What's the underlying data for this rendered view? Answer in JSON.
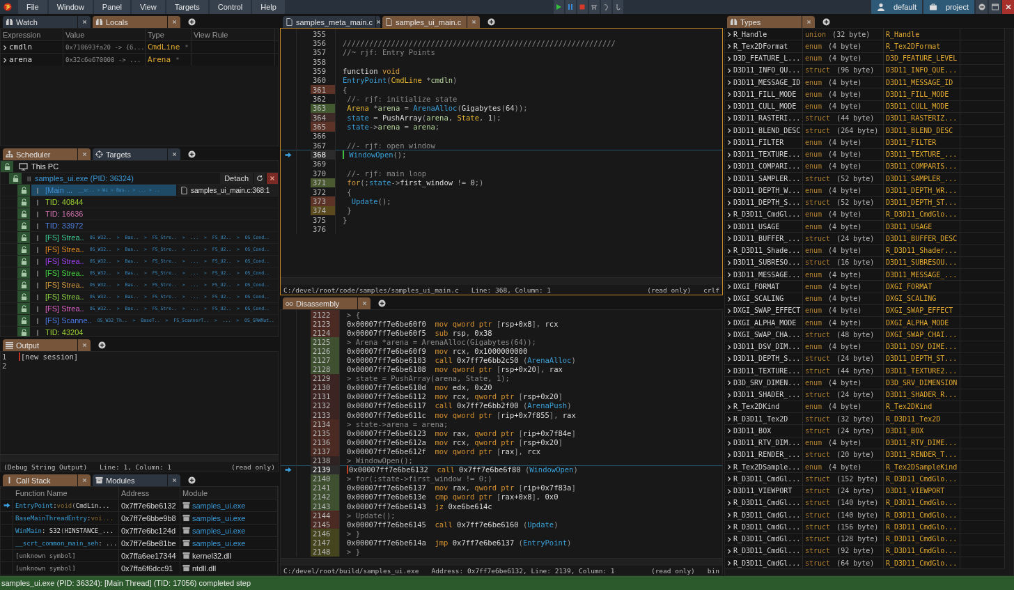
{
  "menu_bar": {
    "items": [
      "File",
      "Window",
      "Panel",
      "View",
      "Targets",
      "Control",
      "Help"
    ],
    "profiles": [
      "default",
      "project"
    ]
  },
  "watch": {
    "tabs": [
      {
        "label": "Watch",
        "selected": false
      },
      {
        "label": "Locals",
        "selected": true
      }
    ],
    "columns": [
      "Expression",
      "Value",
      "Type",
      "View Rule"
    ],
    "rows": [
      {
        "expression": "cmdln",
        "value": "0x710693fa20 -> {6...",
        "type": "CmdLine",
        "marker": "*"
      },
      {
        "expression": "arena",
        "value": "0x32c6e670000 -> ...",
        "type": "Arena",
        "marker": "*"
      }
    ]
  },
  "scheduler": {
    "tabs": [
      {
        "label": "Scheduler",
        "selected": true
      },
      {
        "label": "Targets",
        "selected": false
      }
    ],
    "machine": {
      "label": "This PC"
    },
    "process": {
      "label": "samples_ui.exe (PID: 36324)",
      "button": "Detach"
    },
    "threads": [
      {
        "label": "[Main ...",
        "color": "#3f8fd0",
        "selected": true,
        "trail": "__sc.. > Wi > Bas.. > ... > ..",
        "location": "samples_ui_main.c:368:1"
      },
      {
        "label": "TID: 40844",
        "color": "#9acd32",
        "selected": false
      },
      {
        "label": "TID: 16636",
        "color": "#d070b0",
        "selected": false
      },
      {
        "label": "TID: 33972",
        "color": "#4f7fe0",
        "selected": false
      },
      {
        "label": "[FS] Strea..",
        "color": "#3cc890",
        "selected": false,
        "trail": "OS_W32..  >  Bas..  >  FS_Stre..  >  ...  >  FS_U2..  >  OS_Cond.."
      },
      {
        "label": "[FS] Strea..",
        "color": "#e08a20",
        "selected": false,
        "trail": "OS_W32..  >  Bas..  >  FS_Stre..  >  ...  >  FS_U2..  >  OS_Cond.."
      },
      {
        "label": "[FS] Strea..",
        "color": "#a040f0",
        "selected": false,
        "trail": "OS_W32..  >  Bas..  >  FS_Stre..  >  ...  >  FS_U2..  >  OS_Cond.."
      },
      {
        "label": "[FS] Strea..",
        "color": "#40d040",
        "selected": false,
        "trail": "OS_W32..  >  Bas..  >  FS_Stre..  >  ...  >  FS_U2..  >  OS_Cond.."
      },
      {
        "label": "[FS] Strea..",
        "color": "#d09a40",
        "selected": false,
        "trail": "OS_W32..  >  Bas..  >  FS_Stre..  >  ...  >  FS_U2..  >  OS_Cond.."
      },
      {
        "label": "[FS] Strea..",
        "color": "#8ad040",
        "selected": false,
        "trail": "OS_W32..  >  Bas..  >  FS_Stre..  >  ...  >  FS_U2..  >  OS_Cond.."
      },
      {
        "label": "[FS] Strea..",
        "color": "#e060c8",
        "selected": false,
        "trail": "OS_W32..  >  Bas..  >  FS_Stre..  >  ...  >  FS_U2..  >  OS_Cond.."
      },
      {
        "label": "[FS] Scanne..",
        "color": "#4a7ae8",
        "selected": false,
        "trail": "OS_W32_Th..  >  BaseT..  >  FS_ScannerT..  >  ...  >  OS_SRWMut.."
      },
      {
        "label": "TID: 43204",
        "color": "#9acd32",
        "selected": false
      }
    ]
  },
  "output": {
    "tabs": [
      {
        "label": "Output",
        "selected": true
      }
    ],
    "lines": [
      {
        "n": "1",
        "text": "[new session]"
      },
      {
        "n": "2"
      }
    ],
    "status": [
      "(Debug String Output)",
      "Line: 1, Column: 1",
      "(read only)"
    ]
  },
  "call_stack": {
    "tabs": [
      {
        "label": "Call Stack",
        "selected": true
      },
      {
        "label": "Modules",
        "selected": false
      }
    ],
    "columns": [
      "Function Name",
      "Address",
      "Module"
    ],
    "rows": [
      {
        "current": true,
        "function": [
          {
            "kind": "f",
            "text": "EntryPoint"
          },
          {
            "kind": "p",
            "text": ": "
          },
          {
            "kind": "k",
            "text": "void"
          },
          {
            "kind": "o",
            "text": " ("
          },
          {
            "kind": "p",
            "text": "CmdLin..."
          }
        ],
        "address": "0x7ff7e6be6132",
        "module": "samples_ui.exe",
        "kind": "own"
      },
      {
        "current": false,
        "function": [
          {
            "kind": "f",
            "text": "BaseMainThreadEntry"
          },
          {
            "kind": "p",
            "text": ": "
          },
          {
            "kind": "k",
            "text": "voi..."
          }
        ],
        "address": "0x7ff7e6bbe9b8",
        "module": "samples_ui.exe",
        "kind": "own"
      },
      {
        "current": false,
        "function": [
          {
            "kind": "f",
            "text": "WinMain"
          },
          {
            "kind": "p",
            "text": ": S32 "
          },
          {
            "kind": "o",
            "text": "("
          },
          {
            "kind": "p",
            "text": "HINSTANCE_..."
          }
        ],
        "address": "0x7ff7e6bc124d",
        "module": "samples_ui.exe",
        "kind": "own"
      },
      {
        "current": false,
        "function": [
          {
            "kind": "f",
            "text": "__scrt_common_main_seh"
          },
          {
            "kind": "p",
            "text": ": ..."
          }
        ],
        "address": "0x7ff7e6be81be",
        "module": "samples_ui.exe",
        "kind": "own"
      },
      {
        "current": false,
        "function": [
          {
            "kind": "o",
            "text": "[unknown symbol]"
          }
        ],
        "address": "0x7ffa6ee17344",
        "module": "kernel32.dll",
        "kind": "system"
      },
      {
        "current": false,
        "function": [
          {
            "kind": "o",
            "text": "[unknown symbol]"
          }
        ],
        "address": "0x7ffa6f6dcc91",
        "module": "ntdll.dll",
        "kind": "system"
      }
    ]
  },
  "editor": {
    "tabs": [
      {
        "label": "samples_meta_main.c",
        "selected": false
      },
      {
        "label": "samples_ui_main.c",
        "selected": true
      }
    ],
    "lines": [
      {
        "n": "355",
        "current": false
      },
      {
        "n": "356",
        "current": false,
        "tokens": [
          {
            "kind": "c",
            "text": "//////////////////////////////////////////////////////////////"
          }
        ]
      },
      {
        "n": "357",
        "current": false,
        "tokens": [
          {
            "kind": "c",
            "text": "//~ rjf: Entry Points"
          }
        ]
      },
      {
        "n": "358",
        "current": false
      },
      {
        "n": "359",
        "current": false,
        "tokens": [
          {
            "kind": "p",
            "text": "function "
          },
          {
            "kind": "k",
            "text": "void"
          }
        ]
      },
      {
        "n": "360",
        "current": false,
        "tokens": [
          {
            "kind": "f",
            "text": "EntryPoint"
          },
          {
            "kind": "o",
            "text": "("
          },
          {
            "kind": "t",
            "text": "CmdLine"
          },
          {
            "kind": "o",
            "text": " *"
          },
          {
            "kind": "v",
            "text": "cmdln"
          },
          {
            "kind": "o",
            "text": ")"
          }
        ]
      },
      {
        "n": "361",
        "current": false,
        "color": "#5c3326",
        "tokens": [
          {
            "kind": "o",
            "text": "{"
          }
        ]
      },
      {
        "n": "362",
        "current": false,
        "tokens": [
          {
            "kind": "c",
            "text": " //- rjf: initialize state"
          }
        ]
      },
      {
        "n": "363",
        "current": false,
        "color": "#435a30",
        "tokens": [
          {
            "kind": "t",
            "text": " Arena"
          },
          {
            "kind": "o",
            "text": " *"
          },
          {
            "kind": "v",
            "text": "arena"
          },
          {
            "kind": "o",
            "text": " = "
          },
          {
            "kind": "f",
            "text": "ArenaAlloc"
          },
          {
            "kind": "o",
            "text": "("
          },
          {
            "kind": "p",
            "text": "Gigabytes"
          },
          {
            "kind": "o",
            "text": "("
          },
          {
            "kind": "n",
            "text": "64"
          },
          {
            "kind": "o",
            "text": "));"
          }
        ]
      },
      {
        "n": "364",
        "current": false,
        "color": "#3e2a26",
        "tokens": [
          {
            "kind": "f",
            "text": " state"
          },
          {
            "kind": "o",
            "text": " = "
          },
          {
            "kind": "p",
            "text": "PushArray"
          },
          {
            "kind": "o",
            "text": "("
          },
          {
            "kind": "v",
            "text": "arena"
          },
          {
            "kind": "o",
            "text": ", "
          },
          {
            "kind": "t",
            "text": "State"
          },
          {
            "kind": "o",
            "text": ", "
          },
          {
            "kind": "n",
            "text": "1"
          },
          {
            "kind": "o",
            "text": ");"
          }
        ]
      },
      {
        "n": "365",
        "current": false,
        "color": "#5c3326",
        "tokens": [
          {
            "kind": "f",
            "text": " state"
          },
          {
            "kind": "o",
            "text": "->"
          },
          {
            "kind": "v",
            "text": "arena"
          },
          {
            "kind": "o",
            "text": " = "
          },
          {
            "kind": "v",
            "text": "arena"
          },
          {
            "kind": "o",
            "text": ";"
          }
        ]
      },
      {
        "n": "366",
        "current": false
      },
      {
        "n": "367",
        "current": false,
        "tokens": [
          {
            "kind": "c",
            "text": " //- rjf: open window"
          }
        ]
      },
      {
        "n": "368",
        "current": true,
        "tokens": [
          {
            "kind": "f",
            "text": " WindowOpen"
          },
          {
            "kind": "o",
            "text": "();"
          }
        ]
      },
      {
        "n": "369",
        "current": false
      },
      {
        "n": "370",
        "current": false,
        "tokens": [
          {
            "kind": "c",
            "text": " //- rjf: main loop"
          }
        ]
      },
      {
        "n": "371",
        "current": false,
        "color": "#4b5a30",
        "tokens": [
          {
            "kind": "k",
            "text": " for"
          },
          {
            "kind": "o",
            "text": "(;"
          },
          {
            "kind": "f",
            "text": "state"
          },
          {
            "kind": "o",
            "text": "->"
          },
          {
            "kind": "p",
            "text": "first_window"
          },
          {
            "kind": "o",
            "text": " != "
          },
          {
            "kind": "n",
            "text": "0"
          },
          {
            "kind": "o",
            "text": ";)"
          }
        ]
      },
      {
        "n": "372",
        "current": false,
        "tokens": [
          {
            "kind": "o",
            "text": " {"
          }
        ]
      },
      {
        "n": "373",
        "current": false,
        "color": "#5c3326",
        "tokens": [
          {
            "kind": "f",
            "text": "  Update"
          },
          {
            "kind": "o",
            "text": "();"
          }
        ]
      },
      {
        "n": "374",
        "current": false,
        "color": "#5a4a1e",
        "tokens": [
          {
            "kind": "o",
            "text": " }"
          }
        ]
      },
      {
        "n": "375",
        "current": false,
        "tokens": [
          {
            "kind": "o",
            "text": "}"
          }
        ]
      },
      {
        "n": "376",
        "current": false
      }
    ],
    "status": {
      "path": "C:/devel/root/code/samples/samples_ui_main.c",
      "position": "Line: 368, Column: 1",
      "mode": "(read only)",
      "ending": "crlf"
    }
  },
  "disassembly": {
    "tabs": [
      {
        "label": "Disassembly",
        "selected": true
      }
    ],
    "lines": [
      {
        "n": "2122",
        "current": false,
        "color": "#4a2a22",
        "tokens": [
          {
            "kind": "s",
            "text": "> {"
          }
        ]
      },
      {
        "n": "2123",
        "current": false,
        "color": "#4a2a22",
        "tokens": [
          {
            "kind": "a",
            "text": "0x00007ff7e6be60f0"
          },
          {
            "kind": "m",
            "text": "  mov qword ptr "
          },
          {
            "kind": "o",
            "text": "["
          },
          {
            "kind": "p",
            "text": "rsp+0x8"
          },
          {
            "kind": "o",
            "text": "], "
          },
          {
            "kind": "p",
            "text": "rcx"
          }
        ]
      },
      {
        "n": "2124",
        "current": false,
        "color": "#4a2a22",
        "tokens": [
          {
            "kind": "a",
            "text": "0x00007ff7e6be60f5"
          },
          {
            "kind": "m",
            "text": "  sub "
          },
          {
            "kind": "p",
            "text": "rsp"
          },
          {
            "kind": "o",
            "text": ", "
          },
          {
            "kind": "p",
            "text": "0x38"
          }
        ]
      },
      {
        "n": "2125",
        "current": false,
        "color": "#3e5030",
        "tokens": [
          {
            "kind": "s",
            "text": "> Arena *arena = ArenaAlloc(Gigabytes(64));"
          }
        ]
      },
      {
        "n": "2126",
        "current": false,
        "color": "#3e5030",
        "tokens": [
          {
            "kind": "a",
            "text": "0x00007ff7e6be60f9"
          },
          {
            "kind": "m",
            "text": "  mov "
          },
          {
            "kind": "p",
            "text": "rcx"
          },
          {
            "kind": "o",
            "text": ", "
          },
          {
            "kind": "p",
            "text": "0x1000000000"
          }
        ]
      },
      {
        "n": "2127",
        "current": false,
        "color": "#3e5030",
        "tokens": [
          {
            "kind": "a",
            "text": "0x00007ff7e6be6103"
          },
          {
            "kind": "m",
            "text": "  call "
          },
          {
            "kind": "p",
            "text": "0x7ff7e6bb2c50 "
          },
          {
            "kind": "o",
            "text": "("
          },
          {
            "kind": "f",
            "text": "ArenaAlloc"
          },
          {
            "kind": "o",
            "text": ")"
          }
        ]
      },
      {
        "n": "2128",
        "current": false,
        "color": "#3e5030",
        "tokens": [
          {
            "kind": "a",
            "text": "0x00007ff7e6be6108"
          },
          {
            "kind": "m",
            "text": "  mov qword ptr "
          },
          {
            "kind": "o",
            "text": "["
          },
          {
            "kind": "p",
            "text": "rsp+0x20"
          },
          {
            "kind": "o",
            "text": "], "
          },
          {
            "kind": "p",
            "text": "rax"
          }
        ]
      },
      {
        "n": "2129",
        "current": false,
        "color": "#3b2422",
        "tokens": [
          {
            "kind": "s",
            "text": "> state = PushArray(arena, State, 1);"
          }
        ]
      },
      {
        "n": "2130",
        "current": false,
        "color": "#3b2422",
        "tokens": [
          {
            "kind": "a",
            "text": "0x00007ff7e6be610d"
          },
          {
            "kind": "m",
            "text": "  mov "
          },
          {
            "kind": "p",
            "text": "edx"
          },
          {
            "kind": "o",
            "text": ", "
          },
          {
            "kind": "p",
            "text": "0x20"
          }
        ]
      },
      {
        "n": "2131",
        "current": false,
        "color": "#3b2422",
        "tokens": [
          {
            "kind": "a",
            "text": "0x00007ff7e6be6112"
          },
          {
            "kind": "m",
            "text": "  mov "
          },
          {
            "kind": "p",
            "text": "rcx"
          },
          {
            "kind": "o",
            "text": ", "
          },
          {
            "kind": "m",
            "text": "qword ptr "
          },
          {
            "kind": "o",
            "text": "["
          },
          {
            "kind": "p",
            "text": "rsp+0x20"
          },
          {
            "kind": "o",
            "text": "]"
          }
        ]
      },
      {
        "n": "2132",
        "current": false,
        "color": "#3b2422",
        "tokens": [
          {
            "kind": "a",
            "text": "0x00007ff7e6be6117"
          },
          {
            "kind": "m",
            "text": "  call "
          },
          {
            "kind": "p",
            "text": "0x7ff7e6bb2f00 "
          },
          {
            "kind": "o",
            "text": "("
          },
          {
            "kind": "f",
            "text": "ArenaPush"
          },
          {
            "kind": "o",
            "text": ")"
          }
        ]
      },
      {
        "n": "2133",
        "current": false,
        "color": "#3b2422",
        "tokens": [
          {
            "kind": "a",
            "text": "0x00007ff7e6be611c"
          },
          {
            "kind": "m",
            "text": "  mov qword ptr "
          },
          {
            "kind": "o",
            "text": "["
          },
          {
            "kind": "p",
            "text": "rip+0x7f855"
          },
          {
            "kind": "o",
            "text": "], "
          },
          {
            "kind": "p",
            "text": "rax"
          }
        ]
      },
      {
        "n": "2134",
        "current": false,
        "color": "#4a2a22",
        "tokens": [
          {
            "kind": "s",
            "text": "> state->arena = arena;"
          }
        ]
      },
      {
        "n": "2135",
        "current": false,
        "color": "#4a2a22",
        "tokens": [
          {
            "kind": "a",
            "text": "0x00007ff7e6be6123"
          },
          {
            "kind": "m",
            "text": "  mov "
          },
          {
            "kind": "p",
            "text": "rax"
          },
          {
            "kind": "o",
            "text": ", "
          },
          {
            "kind": "m",
            "text": "qword ptr "
          },
          {
            "kind": "o",
            "text": "["
          },
          {
            "kind": "p",
            "text": "rip+0x7f84e"
          },
          {
            "kind": "o",
            "text": "]"
          }
        ]
      },
      {
        "n": "2136",
        "current": false,
        "color": "#4a2a22",
        "tokens": [
          {
            "kind": "a",
            "text": "0x00007ff7e6be612a"
          },
          {
            "kind": "m",
            "text": "  mov "
          },
          {
            "kind": "p",
            "text": "rcx"
          },
          {
            "kind": "o",
            "text": ", "
          },
          {
            "kind": "m",
            "text": "qword ptr "
          },
          {
            "kind": "o",
            "text": "["
          },
          {
            "kind": "p",
            "text": "rsp+0x20"
          },
          {
            "kind": "o",
            "text": "]"
          }
        ]
      },
      {
        "n": "2137",
        "current": false,
        "color": "#4a2a22",
        "tokens": [
          {
            "kind": "a",
            "text": "0x00007ff7e6be612f"
          },
          {
            "kind": "m",
            "text": "  mov qword ptr "
          },
          {
            "kind": "o",
            "text": "["
          },
          {
            "kind": "p",
            "text": "rax"
          },
          {
            "kind": "o",
            "text": "], "
          },
          {
            "kind": "p",
            "text": "rcx"
          }
        ]
      },
      {
        "n": "2138",
        "current": false,
        "color": "#2e2222",
        "tokens": [
          {
            "kind": "s",
            "text": "> WindowOpen();"
          }
        ]
      },
      {
        "n": "2139",
        "current": true,
        "tokens": [
          {
            "kind": "a",
            "text": "0x00007ff7e6be6132"
          },
          {
            "kind": "m",
            "text": "  call "
          },
          {
            "kind": "p",
            "text": "0x7ff7e6be6f80 "
          },
          {
            "kind": "o",
            "text": "("
          },
          {
            "kind": "f",
            "text": "WindowOpen"
          },
          {
            "kind": "o",
            "text": ")"
          }
        ]
      },
      {
        "n": "2140",
        "current": false,
        "color": "#3e5030",
        "tokens": [
          {
            "kind": "s",
            "text": "> for(;state->first_window != 0;)"
          }
        ]
      },
      {
        "n": "2141",
        "current": false,
        "color": "#3e5030",
        "tokens": [
          {
            "kind": "a",
            "text": "0x00007ff7e6be6137"
          },
          {
            "kind": "m",
            "text": "  mov "
          },
          {
            "kind": "p",
            "text": "rax"
          },
          {
            "kind": "o",
            "text": ", "
          },
          {
            "kind": "m",
            "text": "qword ptr "
          },
          {
            "kind": "o",
            "text": "["
          },
          {
            "kind": "p",
            "text": "rip+0x7f83a"
          },
          {
            "kind": "o",
            "text": "]"
          }
        ]
      },
      {
        "n": "2142",
        "current": false,
        "color": "#3e5030",
        "tokens": [
          {
            "kind": "a",
            "text": "0x00007ff7e6be613e"
          },
          {
            "kind": "m",
            "text": "  cmp qword ptr "
          },
          {
            "kind": "o",
            "text": "["
          },
          {
            "kind": "p",
            "text": "rax+0x8"
          },
          {
            "kind": "o",
            "text": "], "
          },
          {
            "kind": "p",
            "text": "0x0"
          }
        ]
      },
      {
        "n": "2143",
        "current": false,
        "color": "#3e5030",
        "tokens": [
          {
            "kind": "a",
            "text": "0x00007ff7e6be6143"
          },
          {
            "kind": "m",
            "text": "  jz "
          },
          {
            "kind": "p",
            "text": "0xe6be614c"
          }
        ]
      },
      {
        "n": "2144",
        "current": false,
        "color": "#4a2a22",
        "tokens": [
          {
            "kind": "s",
            "text": "> Update();"
          }
        ]
      },
      {
        "n": "2145",
        "current": false,
        "color": "#4a2a22",
        "tokens": [
          {
            "kind": "a",
            "text": "0x00007ff7e6be6145"
          },
          {
            "kind": "m",
            "text": "  call "
          },
          {
            "kind": "p",
            "text": "0x7ff7e6be6160 "
          },
          {
            "kind": "o",
            "text": "("
          },
          {
            "kind": "f",
            "text": "Update"
          },
          {
            "kind": "o",
            "text": ")"
          }
        ]
      },
      {
        "n": "2146",
        "current": false,
        "color": "#44441e",
        "tokens": [
          {
            "kind": "s",
            "text": "> }"
          }
        ]
      },
      {
        "n": "2147",
        "current": false,
        "color": "#44441e",
        "tokens": [
          {
            "kind": "a",
            "text": "0x00007ff7e6be614a"
          },
          {
            "kind": "m",
            "text": "  jmp "
          },
          {
            "kind": "p",
            "text": "0x7ff7e6be6137 "
          },
          {
            "kind": "o",
            "text": "("
          },
          {
            "kind": "f",
            "text": "EntryPoint"
          },
          {
            "kind": "o",
            "text": ")"
          }
        ]
      },
      {
        "n": "2148",
        "current": false,
        "color": "#44441e",
        "tokens": [
          {
            "kind": "s",
            "text": "> }"
          }
        ]
      }
    ],
    "status": {
      "path": "C:/devel/root/build/samples_ui.exe",
      "position": "Address: 0x7ff7e6be6132, Line: 2139, Column: 1",
      "mode": "(read only)",
      "ending": "bin"
    }
  },
  "types": {
    "tabs": [
      {
        "label": "Types",
        "selected": true
      }
    ],
    "rows": [
      {
        "name": "R_Handle",
        "category": "union",
        "size": "(32 byte)",
        "type": "R_Handle"
      },
      {
        "name": "R_Tex2DFormat",
        "category": "enum",
        "size": "(4 byte)",
        "type": "R_Tex2DFormat"
      },
      {
        "name": "D3D_FEATURE_L...",
        "category": "enum",
        "size": "(4 byte)",
        "type": "D3D_FEATURE_LEVEL"
      },
      {
        "name": "D3D11_INFO_QU...",
        "category": "struct",
        "size": "(96 byte)",
        "type": "D3D11_INFO_QUE..."
      },
      {
        "name": "D3D11_MESSAGE_ID",
        "category": "enum",
        "size": "(4 byte)",
        "type": "D3D11_MESSAGE_ID"
      },
      {
        "name": "D3D11_FILL_MODE",
        "category": "enum",
        "size": "(4 byte)",
        "type": "D3D11_FILL_MODE"
      },
      {
        "name": "D3D11_CULL_MODE",
        "category": "enum",
        "size": "(4 byte)",
        "type": "D3D11_CULL_MODE"
      },
      {
        "name": "D3D11_RASTERI...",
        "category": "struct",
        "size": "(44 byte)",
        "type": "D3D11_RASTERIZ..."
      },
      {
        "name": "D3D11_BLEND_DESC",
        "category": "struct",
        "size": "(264 byte)",
        "type": "D3D11_BLEND_DESC"
      },
      {
        "name": "D3D11_FILTER",
        "category": "enum",
        "size": "(4 byte)",
        "type": "D3D11_FILTER"
      },
      {
        "name": "D3D11_TEXTURE...",
        "category": "enum",
        "size": "(4 byte)",
        "type": "D3D11_TEXTURE_..."
      },
      {
        "name": "D3D11_COMPARI...",
        "category": "enum",
        "size": "(4 byte)",
        "type": "D3D11_COMPARIS..."
      },
      {
        "name": "D3D11_SAMPLER...",
        "category": "struct",
        "size": "(52 byte)",
        "type": "D3D11_SAMPLER_..."
      },
      {
        "name": "D3D11_DEPTH_W...",
        "category": "enum",
        "size": "(4 byte)",
        "type": "D3D11_DEPTH_WR..."
      },
      {
        "name": "D3D11_DEPTH_S...",
        "category": "struct",
        "size": "(52 byte)",
        "type": "D3D11_DEPTH_ST..."
      },
      {
        "name": "R_D3D11_CmdGl...",
        "category": "enum",
        "size": "(4 byte)",
        "type": "R_D3D11_CmdGlo..."
      },
      {
        "name": "D3D11_USAGE",
        "category": "enum",
        "size": "(4 byte)",
        "type": "D3D11_USAGE"
      },
      {
        "name": "D3D11_BUFFER_...",
        "category": "struct",
        "size": "(24 byte)",
        "type": "D3D11_BUFFER_DESC"
      },
      {
        "name": "R_D3D11_Shade...",
        "category": "enum",
        "size": "(4 byte)",
        "type": "R_D3D11_Shader..."
      },
      {
        "name": "D3D11_SUBRESO...",
        "category": "struct",
        "size": "(16 byte)",
        "type": "D3D11_SUBRESOU..."
      },
      {
        "name": "D3D11_MESSAGE...",
        "category": "enum",
        "size": "(4 byte)",
        "type": "D3D11_MESSAGE_..."
      },
      {
        "name": "DXGI_FORMAT",
        "category": "enum",
        "size": "(4 byte)",
        "type": "DXGI_FORMAT"
      },
      {
        "name": "DXGI_SCALING",
        "category": "enum",
        "size": "(4 byte)",
        "type": "DXGI_SCALING"
      },
      {
        "name": "DXGI_SWAP_EFFECT",
        "category": "enum",
        "size": "(4 byte)",
        "type": "DXGI_SWAP_EFFECT"
      },
      {
        "name": "DXGI_ALPHA_MODE",
        "category": "enum",
        "size": "(4 byte)",
        "type": "DXGI_ALPHA_MODE"
      },
      {
        "name": "DXGI_SWAP_CHA...",
        "category": "struct",
        "size": "(48 byte)",
        "type": "DXGI_SWAP_CHAI..."
      },
      {
        "name": "D3D11_DSV_DIM...",
        "category": "enum",
        "size": "(4 byte)",
        "type": "D3D11_DSV_DIME..."
      },
      {
        "name": "D3D11_DEPTH_S...",
        "category": "struct",
        "size": "(24 byte)",
        "type": "D3D11_DEPTH_ST..."
      },
      {
        "name": "D3D11_TEXTURE...",
        "category": "struct",
        "size": "(44 byte)",
        "type": "D3D11_TEXTURE2..."
      },
      {
        "name": "D3D_SRV_DIMEN...",
        "category": "enum",
        "size": "(4 byte)",
        "type": "D3D_SRV_DIMENSION"
      },
      {
        "name": "D3D11_SHADER_...",
        "category": "struct",
        "size": "(24 byte)",
        "type": "D3D11_SHADER_R..."
      },
      {
        "name": "R_Tex2DKind",
        "category": "enum",
        "size": "(4 byte)",
        "type": "R_Tex2DKind"
      },
      {
        "name": "R_D3D11_Tex2D",
        "category": "struct",
        "size": "(32 byte)",
        "type": "R_D3D11_Tex2D"
      },
      {
        "name": "D3D11_BOX",
        "category": "struct",
        "size": "(24 byte)",
        "type": "D3D11_BOX"
      },
      {
        "name": "D3D11_RTV_DIM...",
        "category": "enum",
        "size": "(4 byte)",
        "type": "D3D11_RTV_DIME..."
      },
      {
        "name": "D3D11_RENDER_...",
        "category": "struct",
        "size": "(20 byte)",
        "type": "D3D11_RENDER_T..."
      },
      {
        "name": "R_Tex2DSample...",
        "category": "enum",
        "size": "(4 byte)",
        "type": "R_Tex2DSampleKind"
      },
      {
        "name": "R_D3D11_CmdGl...",
        "category": "struct",
        "size": "(152 byte)",
        "type": "R_D3D11_CmdGlo..."
      },
      {
        "name": "D3D11_VIEWPORT",
        "category": "struct",
        "size": "(24 byte)",
        "type": "D3D11_VIEWPORT"
      },
      {
        "name": "R_D3D11_CmdGl...",
        "category": "struct",
        "size": "(140 byte)",
        "type": "R_D3D11_CmdGlo..."
      },
      {
        "name": "R_D3D11_CmdGl...",
        "category": "struct",
        "size": "(140 byte)",
        "type": "R_D3D11_CmdGlo..."
      },
      {
        "name": "R_D3D11_CmdGl...",
        "category": "struct",
        "size": "(156 byte)",
        "type": "R_D3D11_CmdGlo..."
      },
      {
        "name": "R_D3D11_CmdGl...",
        "category": "struct",
        "size": "(128 byte)",
        "type": "R_D3D11_CmdGlo..."
      },
      {
        "name": "R_D3D11_CmdGl...",
        "category": "struct",
        "size": "(92 byte)",
        "type": "R_D3D11_CmdGlo..."
      },
      {
        "name": "R_D3D11_CmdGl...",
        "category": "struct",
        "size": "(64 byte)",
        "type": "R_D3D11_CmdGlo..."
      }
    ]
  },
  "status_bar": {
    "text": "samples_ui.exe (PID: 36324): [Main Thread] (TID: 17056) completed step"
  }
}
